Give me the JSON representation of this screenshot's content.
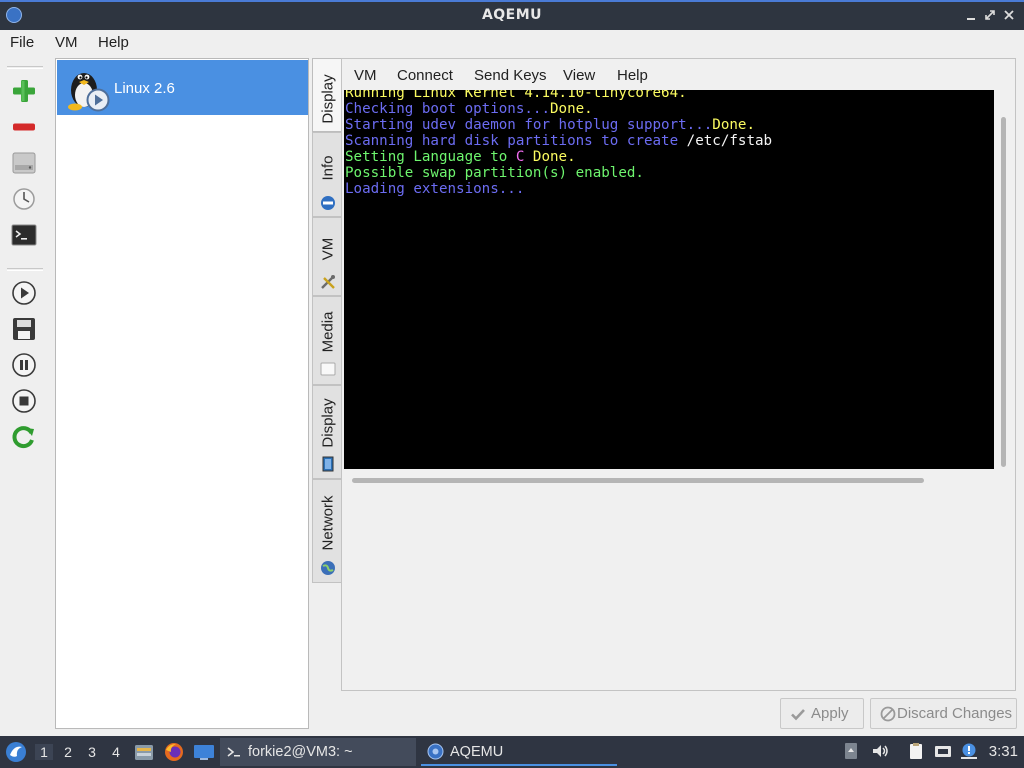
{
  "window": {
    "title": "AQEMU",
    "controls": [
      "minimize",
      "maximize",
      "close"
    ]
  },
  "menubar": {
    "items": [
      "File",
      "VM",
      "Help"
    ]
  },
  "toolbar": {
    "icons": [
      "add-vm-icon",
      "remove-vm-icon",
      "hard-disk-icon",
      "clock-icon",
      "terminal-icon",
      "play-icon",
      "save-icon",
      "pause-icon",
      "stop-icon",
      "reset-icon"
    ]
  },
  "vm_list": {
    "items": [
      {
        "label": "Linux 2.6",
        "selected": true
      }
    ]
  },
  "vertical_tabs": [
    {
      "label": "Display",
      "active": true
    },
    {
      "label": "Info"
    },
    {
      "label": "VM"
    },
    {
      "label": "Media"
    },
    {
      "label": "Display"
    },
    {
      "label": "Network"
    }
  ],
  "display_menu": {
    "items": [
      "VM",
      "Connect",
      "Send Keys",
      "View",
      "Help"
    ]
  },
  "console": {
    "lines": [
      [
        {
          "text": "Running Linux Kernel 4.14.10-tinycore64.",
          "color": "yellow"
        }
      ],
      [
        {
          "text": "Checking boot options...",
          "color": "blue"
        },
        {
          "text": "Done.",
          "color": "yellow"
        }
      ],
      [
        {
          "text": "Starting udev daemon for hotplug support...",
          "color": "blue"
        },
        {
          "text": "Done.",
          "color": "yellow"
        }
      ],
      [
        {
          "text": "Scanning hard disk partitions to create ",
          "color": "blue"
        },
        {
          "text": "/etc/fstab",
          "color": "white"
        }
      ],
      [
        {
          "text": "Setting Language to ",
          "color": "green"
        },
        {
          "text": "C",
          "color": "magenta"
        },
        {
          "text": " Done.",
          "color": "yellow"
        }
      ],
      [
        {
          "text": "Possible swap partition(s) enabled.",
          "color": "green"
        }
      ],
      [
        {
          "text": "Loading extensions...",
          "color": "blue"
        }
      ]
    ]
  },
  "buttons": {
    "apply": "Apply",
    "discard": "Discard Changes"
  },
  "taskbar": {
    "workspaces": [
      "1",
      "2",
      "3",
      "4"
    ],
    "active_workspace": "1",
    "tasks": [
      {
        "label": "forkie2@VM3: ~",
        "icon": "terminal-icon"
      },
      {
        "label": "AQEMU",
        "icon": "aqemu-icon"
      }
    ],
    "clock": "3:31"
  },
  "colors": {
    "selection": "#4a90e2",
    "titlebar": "#2e3540",
    "console_bg": "#000000"
  }
}
